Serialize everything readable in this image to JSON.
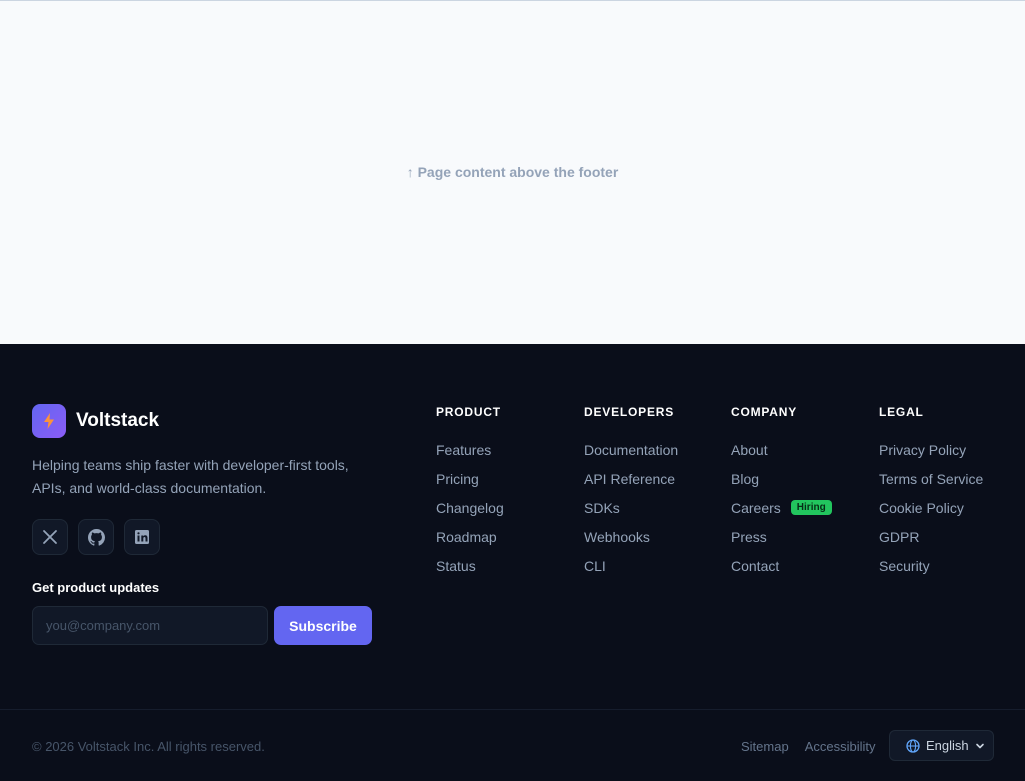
{
  "page": {
    "hint": "↑ Page content above the footer"
  },
  "brand": {
    "name": "Voltstack",
    "tagline": "Helping teams ship faster with developer-first tools, APIs, and world-class documentation."
  },
  "socials": [
    {
      "icon": "x-twitter-icon"
    },
    {
      "icon": "github-icon"
    },
    {
      "icon": "linkedin-icon"
    }
  ],
  "newsletter": {
    "title": "Get product updates",
    "placeholder": "you@company.com",
    "button": "Subscribe"
  },
  "columns": [
    {
      "title": "PRODUCT",
      "links": [
        "Features",
        "Pricing",
        "Changelog",
        "Roadmap",
        "Status"
      ]
    },
    {
      "title": "DEVELOPERS",
      "links": [
        "Documentation",
        "API Reference",
        "SDKs",
        "Webhooks",
        "CLI"
      ]
    },
    {
      "title": "COMPANY",
      "links": [
        "About",
        "Blog",
        "Careers",
        "Press",
        "Contact"
      ],
      "badge": "Hiring"
    },
    {
      "title": "LEGAL",
      "links": [
        "Privacy Policy",
        "Terms of Service",
        "Cookie Policy",
        "GDPR",
        "Security"
      ]
    }
  ],
  "bottom": {
    "copyright": "© 2026 Voltstack Inc. All rights reserved.",
    "links": [
      "Sitemap",
      "Accessibility"
    ],
    "language": "English"
  },
  "colors": {
    "accent": "#6366f1",
    "badge": "#22c55e",
    "footer_bg": "#0a0e1a"
  }
}
